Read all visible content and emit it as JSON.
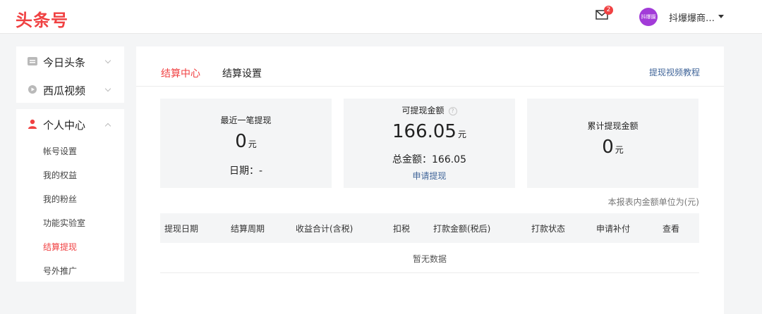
{
  "header": {
    "logo": "头条号",
    "mail_badge": "2",
    "avatar_text": "抖爆摄",
    "username": "抖爆爆商…"
  },
  "sidebar": {
    "top_items": [
      {
        "label": "今日头条",
        "icon": "toutiao-badge-icon"
      },
      {
        "label": "西瓜视频",
        "icon": "play-circle-icon"
      }
    ],
    "personal": {
      "label": "个人中心",
      "icon": "user-icon",
      "subitems": [
        "帐号设置",
        "我的权益",
        "我的粉丝",
        "功能实验室",
        "结算提现",
        "号外推广"
      ],
      "active_index": 4
    }
  },
  "main": {
    "tabs": [
      "结算中心",
      "结算设置"
    ],
    "tutorial_link": "提现视频教程",
    "cards": {
      "recent": {
        "title": "最近一笔提现",
        "value": "0",
        "unit": "元",
        "date": "日期：-"
      },
      "available": {
        "title": "可提现金额",
        "value": "166.05",
        "unit": "元",
        "total": "总金额：166.05",
        "apply": "申请提现"
      },
      "cumulative": {
        "title": "累计提现金额",
        "value": "0",
        "unit": "元"
      }
    },
    "unit_note": "本报表内金额单位为(元)",
    "table": {
      "columns": [
        "提现日期",
        "结算周期",
        "收益合计(含税)",
        "扣税",
        "打款金额(税后)",
        "打款状态",
        "申请补付",
        "查看"
      ],
      "empty_text": "暂无数据"
    }
  },
  "colors": {
    "accent": "#f04142",
    "link": "#406599",
    "card_bg": "#f4f5f6"
  }
}
